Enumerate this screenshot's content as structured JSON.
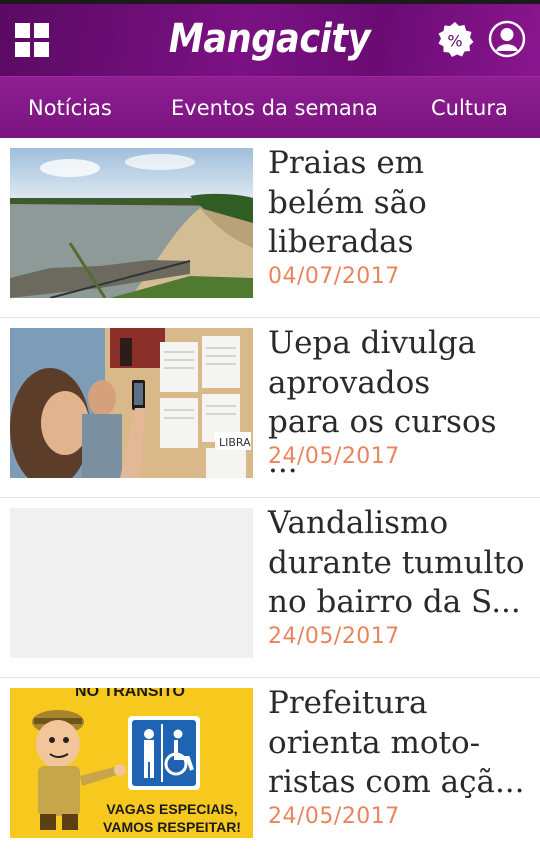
{
  "app": {
    "title": "Mangacity"
  },
  "header": {
    "icons": [
      "grid-menu-icon",
      "percent-badge-icon",
      "user-profile-icon"
    ]
  },
  "tabs": [
    {
      "label": "Notícias"
    },
    {
      "label": "Eventos da semana"
    },
    {
      "label": "Cultura"
    }
  ],
  "articles": [
    {
      "title": "Praias em\nbelém são\nliberadas",
      "date": "04/07/2017",
      "thumbnail": "beach-photo"
    },
    {
      "title": "Uepa divulga\naprovados\npara os cursos ...",
      "date": "24/05/2017",
      "thumbnail": "notice-board-photo"
    },
    {
      "title": "Vandalismo\ndurante tumulto\nno bairro da S...",
      "date": "24/05/2017",
      "thumbnail": "empty-placeholder"
    },
    {
      "title": "Prefeitura\norienta moto-\nristas com açã...",
      "date": "24/05/2017",
      "thumbnail": "traffic-poster"
    }
  ],
  "poster": {
    "top_text": "NO TRÂNSITO",
    "bottom_line1": "VAGAS ESPECIAIS,",
    "bottom_line2": "VAMOS RESPEITAR!"
  },
  "colors": {
    "brand": "#7b1184",
    "tab_bar": "#8a1a8e",
    "date": "#e9855e",
    "title": "#2a2a2a"
  }
}
